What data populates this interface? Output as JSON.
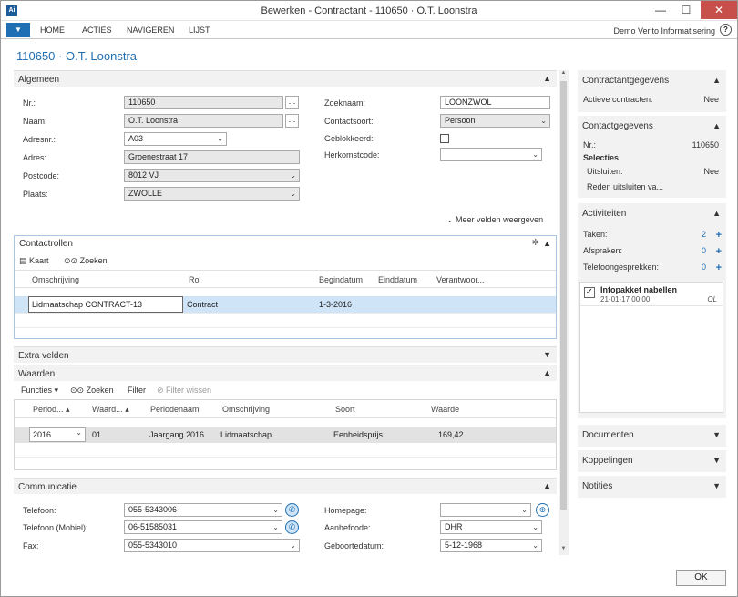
{
  "window": {
    "title": "Bewerken - Contractant - 110650 · O.T. Loonstra",
    "app_icon": "Ai",
    "minimize": "—",
    "maximize": "☐",
    "close": "✕"
  },
  "ribbon": {
    "tabs": [
      "HOME",
      "ACTIES",
      "NAVIGEREN",
      "LIJST"
    ],
    "company": "Demo Verito Informatisering",
    "help": "?"
  },
  "page_title": "110650 · O.T. Loonstra",
  "algemeen": {
    "title": "Algemeen",
    "left": [
      {
        "label": "Nr.:",
        "value": "110650"
      },
      {
        "label": "Naam:",
        "value": "O.T. Loonstra"
      },
      {
        "label": "Adresnr.:",
        "value": "A03"
      },
      {
        "label": "Adres:",
        "value": "Groenestraat 17"
      },
      {
        "label": "Postcode:",
        "value": "8012 VJ"
      },
      {
        "label": "Plaats:",
        "value": "ZWOLLE"
      }
    ],
    "right": [
      {
        "label": "Zoeknaam:",
        "value": "LOONZWOL"
      },
      {
        "label": "Contactsoort:",
        "value": "Persoon"
      },
      {
        "label": "Geblokkeerd:",
        "value": ""
      },
      {
        "label": "Herkomstcode:",
        "value": ""
      }
    ],
    "ellipsis": "...",
    "more_fields": "Meer velden weergeven"
  },
  "contactrollen": {
    "title": "Contactrollen",
    "toolbar": [
      "Kaart",
      "Zoeken"
    ],
    "columns": [
      "Omschrijving",
      "Rol",
      "Begindatum",
      "Einddatum",
      "Verantwoor..."
    ],
    "rows": [
      {
        "omschrijving": "Lidmaatschap CONTRACT-13",
        "rol": "Contract",
        "begindatum": "1-3-2016",
        "einddatum": "",
        "verantwoordelijke": ""
      }
    ]
  },
  "extra_velden": {
    "title": "Extra velden"
  },
  "waarden": {
    "title": "Waarden",
    "toolbar": [
      "Functies",
      "Zoeken",
      "Filter",
      "Filter wissen"
    ],
    "columns": [
      "Period...",
      "Waard...",
      "Periodenaam",
      "Omschrijving",
      "Soort",
      "Waarde"
    ],
    "rows": [
      {
        "periode": "2016",
        "waarde_nr": "01",
        "periodenaam": "Jaargang 2016",
        "omschrijving": "Lidmaatschap",
        "soort": "Eenheidsprijs",
        "waarde": "169,42"
      }
    ]
  },
  "communicatie": {
    "title": "Communicatie",
    "left": [
      {
        "label": "Telefoon:",
        "value": "055-5343006"
      },
      {
        "label": "Telefoon (Mobiel):",
        "value": "06-51585031"
      },
      {
        "label": "Fax:",
        "value": "055-5343010"
      }
    ],
    "right": [
      {
        "label": "Homepage:",
        "value": ""
      },
      {
        "label": "Aanhefcode:",
        "value": "DHR"
      },
      {
        "label": "Geboortedatum:",
        "value": "5-12-1968"
      }
    ]
  },
  "factboxes": {
    "contractant": {
      "title": "Contractantgegevens",
      "label": "Actieve contracten:",
      "value": "Nee"
    },
    "contact": {
      "title": "Contactgegevens",
      "nr_label": "Nr.:",
      "nr_value": "110650",
      "selecties": "Selecties",
      "uitsluiten_label": "Uitsluiten:",
      "uitsluiten_value": "Nee",
      "reden": "Reden uitsluiten va..."
    },
    "activiteiten": {
      "title": "Activiteiten",
      "rows": [
        {
          "label": "Taken:",
          "value": "2"
        },
        {
          "label": "Afspraken:",
          "value": "0"
        },
        {
          "label": "Telefoongesprekken:",
          "value": "0"
        }
      ],
      "task": {
        "title": "Infopakket nabellen",
        "datetime": "21-01-17 00:00",
        "user": "OL"
      }
    },
    "documenten": {
      "title": "Documenten"
    },
    "koppelingen": {
      "title": "Koppelingen"
    },
    "notities": {
      "title": "Notities"
    }
  },
  "ok_button": "OK"
}
